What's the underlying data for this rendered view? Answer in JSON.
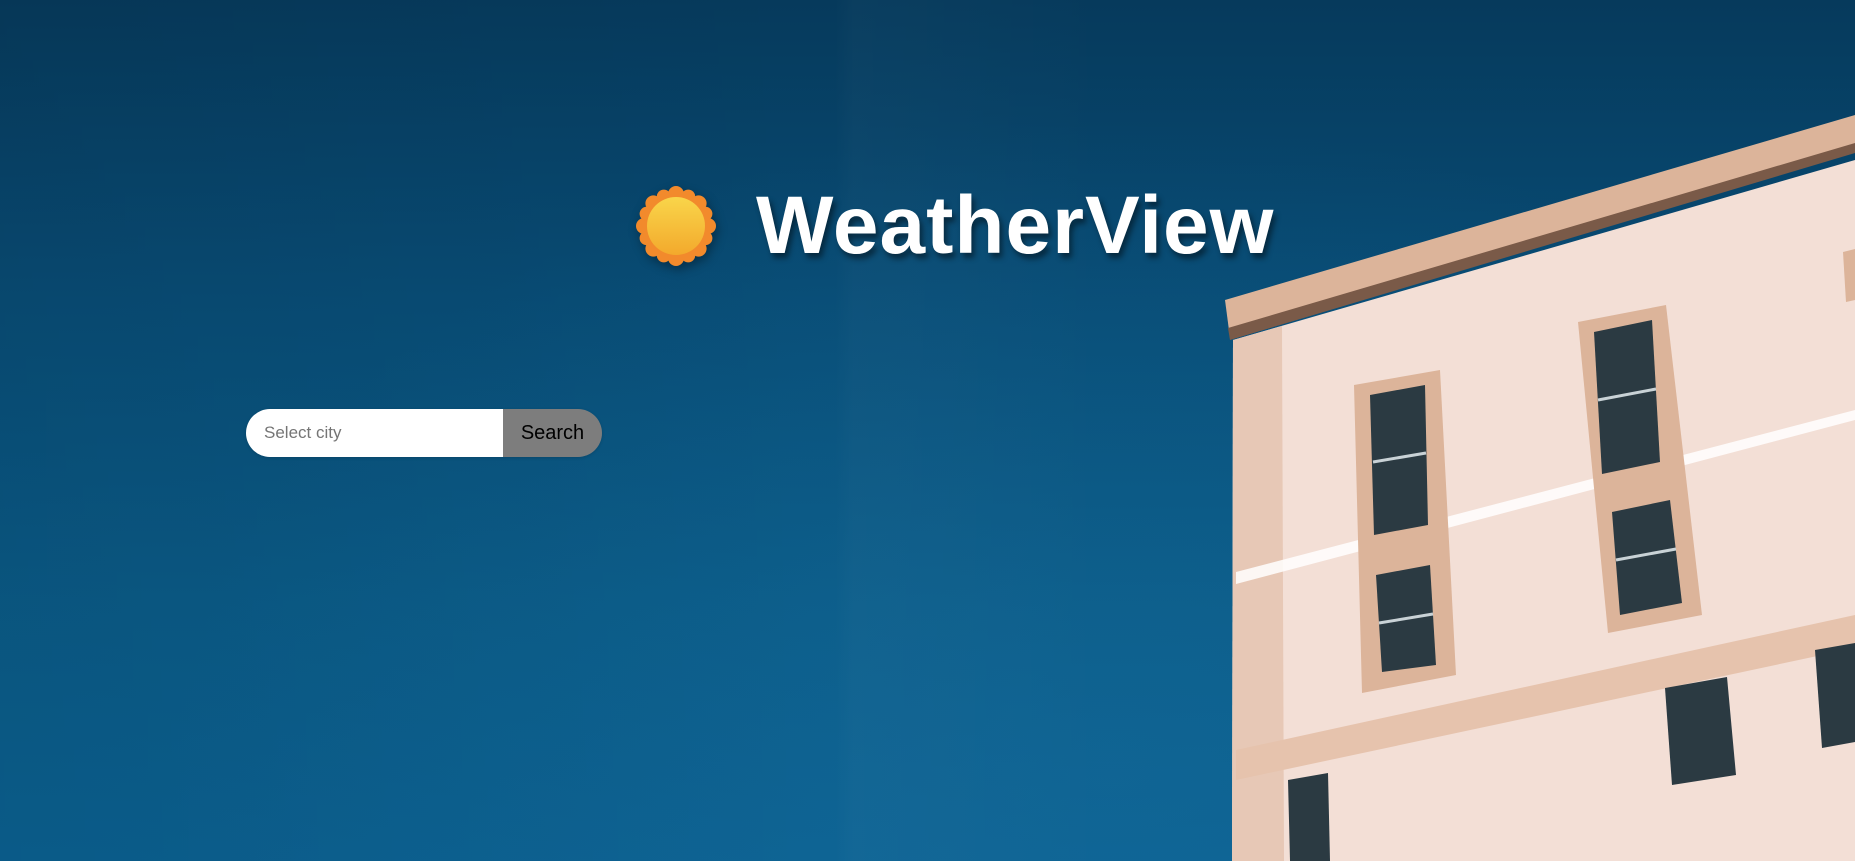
{
  "app": {
    "title": "WeatherView"
  },
  "search": {
    "placeholder": "Select city",
    "value": "",
    "button_label": "Search"
  },
  "icons": {
    "logo": "sun-icon"
  },
  "colors": {
    "sky_top": "#063a5c",
    "sky_bottom": "#0b6090",
    "building_wall": "#f3dfd6",
    "building_trim": "#dcb49a",
    "sun_outer": "#f28a2c",
    "sun_inner": "#f7c53c",
    "search_button_bg": "#7d7d7d"
  }
}
